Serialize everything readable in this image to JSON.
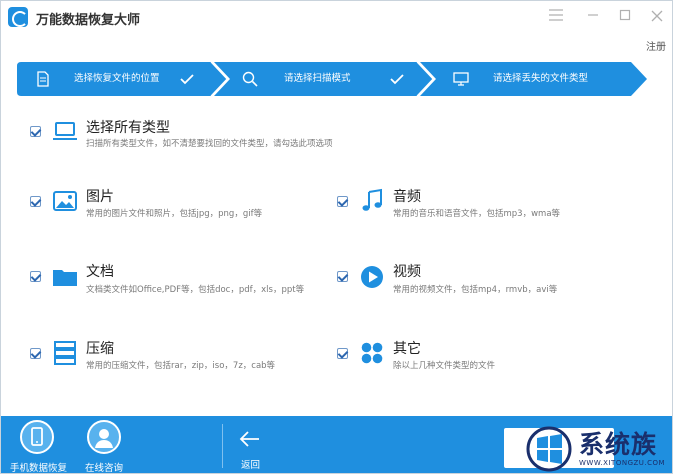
{
  "app": {
    "title": "万能数据恢复大师",
    "register_label": "注册"
  },
  "window_controls": {
    "menu": "menu-icon",
    "minimize": "minimize-icon",
    "maximize": "maximize-icon",
    "close": "close-icon"
  },
  "steps": [
    {
      "label": "选择恢复文件的位置",
      "icon": "document-icon",
      "done": true
    },
    {
      "label": "请选择扫描模式",
      "icon": "search-icon",
      "done": true
    },
    {
      "label": "请选择丢失的文件类型",
      "icon": "monitor-icon",
      "done": false
    }
  ],
  "items": {
    "all": {
      "title": "选择所有类型",
      "desc": "扫描所有类型文件，如不清楚要找回的文件类型，请勾选此项选项",
      "icon": "laptop-icon",
      "checked": true
    },
    "images": {
      "title": "图片",
      "desc": "常用的图片文件和照片，包括jpg，png，gif等",
      "icon": "image-icon",
      "checked": true
    },
    "audio": {
      "title": "音频",
      "desc": "常用的音乐和语音文件，包括mp3，wma等",
      "icon": "music-icon",
      "checked": true
    },
    "docs": {
      "title": "文档",
      "desc": "文档类文件如Office,PDF等，包括doc，pdf，xls，ppt等",
      "icon": "folder-icon",
      "checked": true
    },
    "video": {
      "title": "视频",
      "desc": "常用的视频文件，包括mp4，rmvb，avi等",
      "icon": "play-icon",
      "checked": true
    },
    "archive": {
      "title": "压缩",
      "desc": "常用的压缩文件，包括rar，zip，iso，7z，cab等",
      "icon": "archive-icon",
      "checked": true
    },
    "other": {
      "title": "其它",
      "desc": "除以上几种文件类型的文件",
      "icon": "grid-icon",
      "checked": true
    }
  },
  "bottom": {
    "phone_recovery": "手机数据恢复",
    "online_consult": "在线咨询",
    "back": "返回"
  },
  "watermark": {
    "text": "系统族",
    "url": "WWW.XITONGZU.COM"
  },
  "colors": {
    "accent": "#1f8fdf",
    "check": "#2d67b0",
    "icon_blue": "#1f8fdf"
  }
}
